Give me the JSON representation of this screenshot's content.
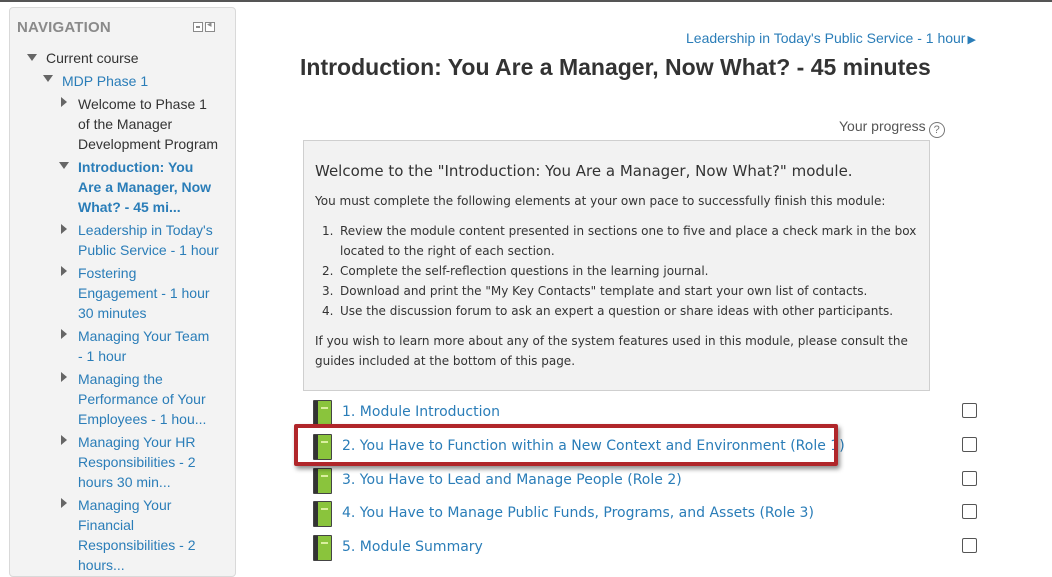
{
  "nav": {
    "title": "NAVIGATION",
    "items": [
      {
        "lines": [
          "Current course"
        ]
      },
      {
        "lines": [
          "MDP Phase 1"
        ]
      },
      {
        "lines": [
          "Welcome to Phase 1",
          "of the Manager",
          "Development Program"
        ]
      },
      {
        "lines": [
          "Introduction: You",
          "Are a Manager, Now",
          "What? - 45 mi..."
        ]
      },
      {
        "lines": [
          "Leadership in Today's",
          "Public Service - 1 hour"
        ]
      },
      {
        "lines": [
          "Fostering",
          "Engagement - 1 hour",
          "30 minutes"
        ]
      },
      {
        "lines": [
          "Managing Your Team",
          "- 1 hour"
        ]
      },
      {
        "lines": [
          "Managing the",
          "Performance of Your",
          "Employees - 1 hou..."
        ]
      },
      {
        "lines": [
          "Managing Your HR",
          "Responsibilities - 2",
          "hours 30 min..."
        ]
      },
      {
        "lines": [
          "Managing Your",
          "Financial",
          "Responsibilities - 2",
          "hours..."
        ]
      }
    ]
  },
  "main": {
    "next_link": "Leadership in Today's Public Service - 1 hour",
    "next_arrow": "▶",
    "title": "Introduction: You Are a Manager, Now What? - 45 minutes",
    "progress_label": "Your progress",
    "help_icon": "?",
    "summary": {
      "heading": "Welcome to the \"Introduction: You Are a Manager, Now What?\" module.",
      "intro": "You must complete the following elements at your own pace to successfully finish this module:",
      "steps": [
        {
          "num": "1.",
          "text": "Review the module content presented in sections one to five and place a check mark in the box located to the right of each section."
        },
        {
          "num": "2.",
          "text": "Complete the self-reflection questions in the learning journal."
        },
        {
          "num": "3.",
          "text": "Download and print the \"My Key Contacts\" template and start your own list of contacts."
        },
        {
          "num": "4.",
          "text": "Use the discussion forum to ask an expert a question or share ideas with other participants."
        }
      ],
      "outro": "If you wish to learn more about any of the system features used in this module, please consult the guides included at the bottom of this page."
    },
    "modules": [
      "1. Module Introduction",
      "2. You Have to Function within a New Context and Environment (Role 1)",
      "3. You Have to Lead and Manage People (Role 2)",
      "4. You Have to Manage Public Funds, Programs, and Assets (Role 3)",
      "5. Module Summary"
    ]
  }
}
